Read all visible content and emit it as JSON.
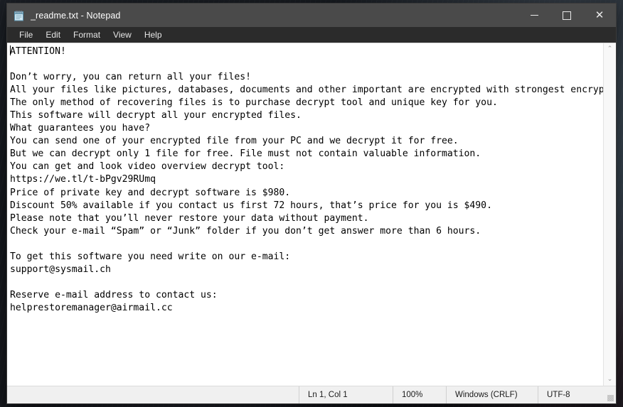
{
  "window": {
    "title": "_readme.txt - Notepad",
    "icon": "notepad-icon",
    "controls": {
      "minimize": "—",
      "maximize": "□",
      "close": "✕"
    }
  },
  "menubar": {
    "items": [
      {
        "label": "File"
      },
      {
        "label": "Edit"
      },
      {
        "label": "Format"
      },
      {
        "label": "View"
      },
      {
        "label": "Help"
      }
    ]
  },
  "editor": {
    "content": "ATTENTION!\n\nDon’t worry, you can return all your files!\nAll your files like pictures, databases, documents and other important are encrypted with strongest encryption and unique key.\nThe only method of recovering files is to purchase decrypt tool and unique key for you.\nThis software will decrypt all your encrypted files.\nWhat guarantees you have?\nYou can send one of your encrypted file from your PC and we decrypt it for free.\nBut we can decrypt only 1 file for free. File must not contain valuable information.\nYou can get and look video overview decrypt tool:\nhttps://we.tl/t-bPgv29RUmq\nPrice of private key and decrypt software is $980.\nDiscount 50% available if you contact us first 72 hours, that’s price for you is $490.\nPlease note that you’ll never restore your data without payment.\nCheck your e-mail “Spam” or “Junk” folder if you don’t get answer more than 6 hours.\n\nTo get this software you need write on our e-mail:\nsupport@sysmail.ch\n\nReserve e-mail address to contact us:\nhelprestoremanager@airmail.cc",
    "ransom_details": {
      "price_full": "$980",
      "price_discounted": "$490",
      "discount_percent": "50%",
      "discount_window": "72 hours",
      "response_time": "6 hours",
      "free_files": "1 file",
      "video_url": "https://we.tl/t-bPgv29RUmq",
      "primary_email": "support@sysmail.ch",
      "reserve_email": "helprestoremanager@airmail.cc"
    }
  },
  "scrollbar": {
    "up_arrow": "⌃",
    "down_arrow": "⌄"
  },
  "statusbar": {
    "position": "Ln 1, Col 1",
    "zoom": "100%",
    "line_ending": "Windows (CRLF)",
    "encoding": "UTF-8"
  },
  "colors": {
    "titlebar": "#4a4a4a",
    "menubar": "#2b2b2b",
    "editor_bg": "#ffffff",
    "editor_fg": "#000000",
    "statusbar": "#f0f0f0",
    "close_hover": "#c42b1c"
  }
}
